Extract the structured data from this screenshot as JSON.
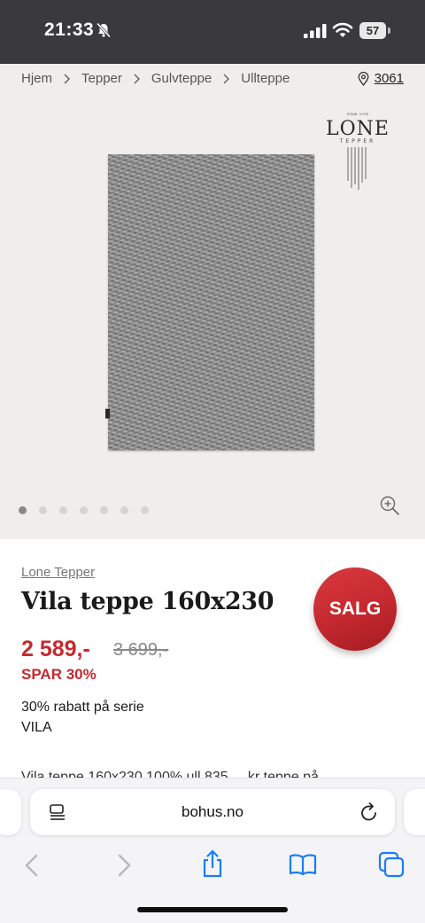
{
  "status_bar": {
    "time": "21:33",
    "battery": "57",
    "icons": [
      "bell-slash-icon",
      "cellular-signal-icon",
      "wifi-icon",
      "battery-icon"
    ]
  },
  "breadcrumb": {
    "items": [
      "Hjem",
      "Tepper",
      "Gulvteppe",
      "Ullteppe"
    ],
    "separator_icon": "chevron-right-icon"
  },
  "store": {
    "icon": "location-pin-icon",
    "number": "3061"
  },
  "gallery": {
    "slide_count": 7,
    "active_index": 0,
    "zoom_icon": "zoom-in-icon"
  },
  "product": {
    "vendor": "Lone Tepper",
    "title": "Vila teppe 160x230",
    "price": "2 589,-",
    "old_price": "3 699,-",
    "savings": "SPAR 30%",
    "campaign_text": "30% rabatt på serie VILA",
    "badge": "SALG",
    "description_partial": "Vila teppe 160x230 100% ull 835 ... kr teppe på"
  },
  "browser": {
    "url": "bohus.no",
    "icons": [
      "reader-icon",
      "reload-icon",
      "back-icon",
      "forward-icon",
      "share-icon",
      "bookmarks-icon",
      "tabs-icon"
    ]
  },
  "colors": {
    "accent_red": "#c8282e",
    "status_bar_bg": "#3a3a3c",
    "gallery_bg": "#f0eeed"
  }
}
